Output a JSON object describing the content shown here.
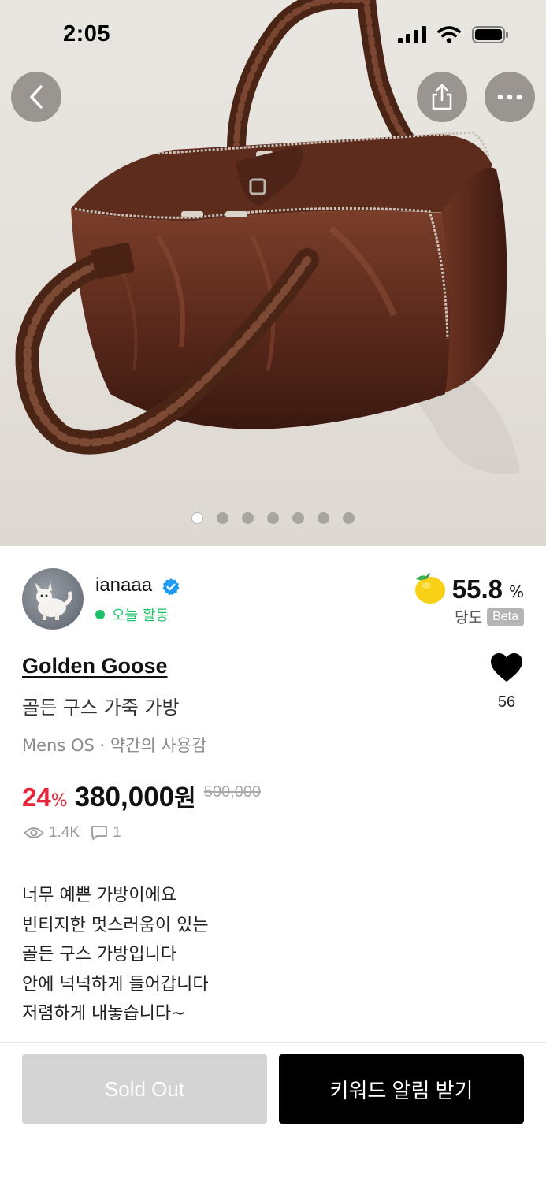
{
  "status_bar": {
    "time": "2:05",
    "icons": [
      "signal-icon",
      "wifi-icon",
      "battery-icon"
    ]
  },
  "top_actions": {
    "back_icon": "chevron-left-icon",
    "share_icon": "share-icon",
    "more_icon": "more-horizontal-icon"
  },
  "gallery": {
    "image_count": 7,
    "active_index": 0
  },
  "seller": {
    "name": "ianaaa",
    "verified": true,
    "activity": "오늘 활동",
    "activity_color": "#1ec26a",
    "sweetness_value": "55.8",
    "sweetness_unit": "%",
    "sweetness_label": "당도",
    "beta_badge": "Beta"
  },
  "product": {
    "brand": "Golden Goose",
    "title": "골든 구스 가죽 가방",
    "meta": "Mens OS · 약간의 사용감",
    "like_count": "56",
    "discount": "24",
    "discount_unit": "%",
    "price": "380,000",
    "price_unit": "원",
    "original_price": "500,000",
    "views": "1.4K",
    "comments": "1",
    "description": [
      "너무 예쁜 가방이에요",
      "빈티지한 멋스러움이 있는",
      "골든 구스 가방입니다",
      "안에 넉넉하게 들어갑니다",
      "저렴하게 내놓습니다~"
    ]
  },
  "actions": {
    "sold_out_label": "Sold Out",
    "keyword_alert_label": "키워드 알림 받기"
  },
  "colors": {
    "discount": "#e8263a",
    "primary_button": "#000000",
    "disabled_button": "#d4d4d4",
    "verified": "#1d9bf0"
  }
}
